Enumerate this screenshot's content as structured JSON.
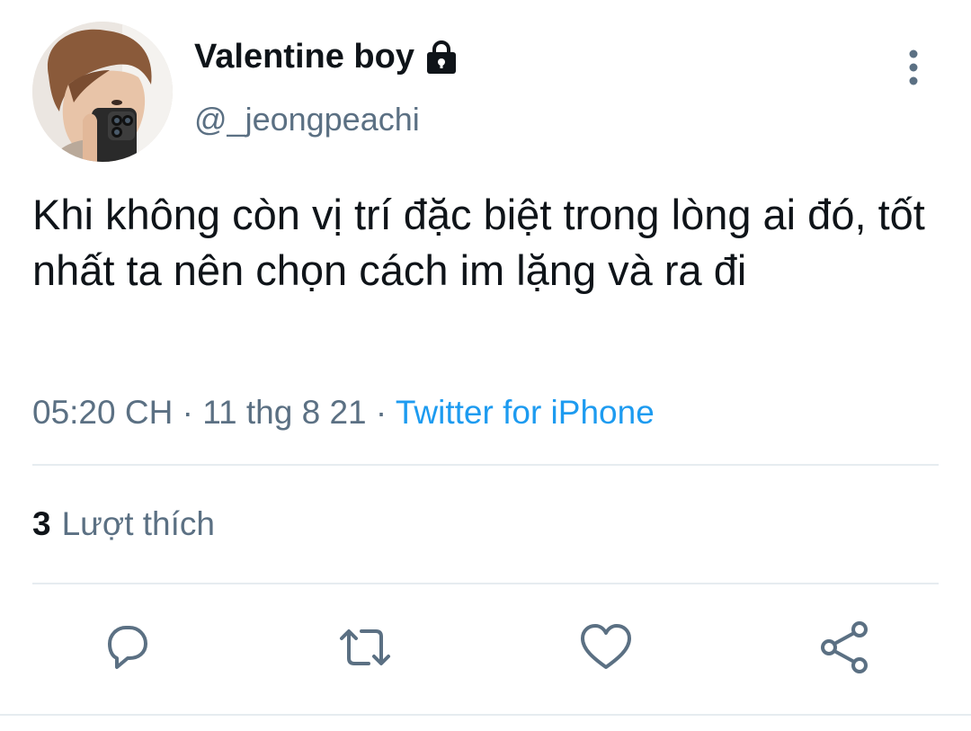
{
  "author": {
    "display_name": "Valentine boy",
    "handle": "@_jeongpeachi",
    "protected_icon": "lock-icon",
    "avatar": "profile-photo"
  },
  "tweet": {
    "text": "Khi không còn vị trí đặc biệt trong lòng ai đó, tốt nhất ta nên chọn cách im lặng và ra đi",
    "time": "05:20 CH",
    "separator": "·",
    "date": "11 thg 8 21",
    "source": "Twitter for iPhone"
  },
  "stats": {
    "likes_count": "3",
    "likes_label": "Lượt thích"
  },
  "actions": [
    {
      "name": "reply",
      "icon": "speech-bubble-icon"
    },
    {
      "name": "retweet",
      "icon": "retweet-arrows-icon"
    },
    {
      "name": "like",
      "icon": "heart-icon"
    },
    {
      "name": "share",
      "icon": "share-nodes-icon"
    }
  ],
  "menu_icon": "more-vertical-icon",
  "colors": {
    "text_primary": "#0f1419",
    "text_secondary": "#5b7083",
    "link": "#1d9bf0",
    "divider": "#e6ecf0"
  }
}
